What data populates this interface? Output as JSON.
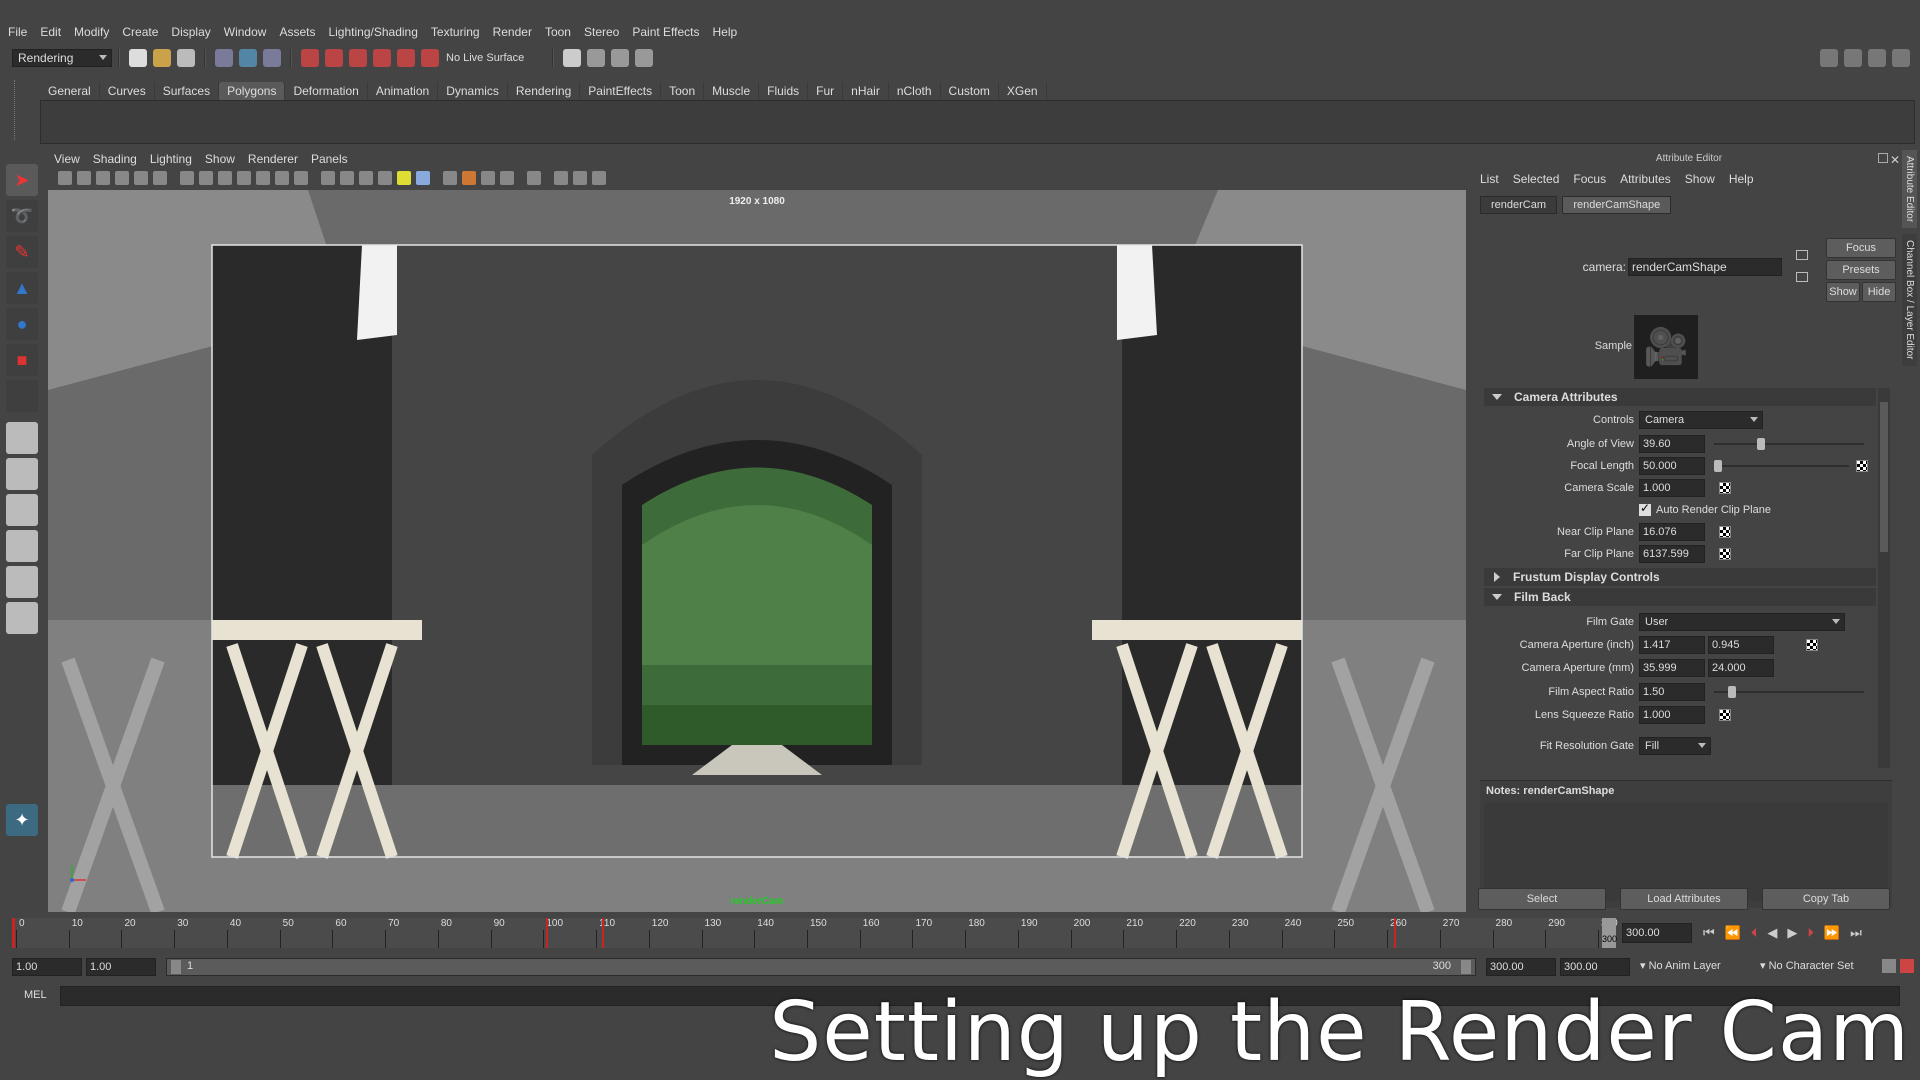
{
  "menubar": {
    "items": [
      "File",
      "Edit",
      "Modify",
      "Create",
      "Display",
      "Window",
      "Assets",
      "Lighting/Shading",
      "Texturing",
      "Render",
      "Toon",
      "Stereo",
      "Paint Effects",
      "Help"
    ]
  },
  "status_line": {
    "menu_set": "Rendering",
    "live_surface": "No Live Surface"
  },
  "shelf": {
    "tabs": [
      "General",
      "Curves",
      "Surfaces",
      "Polygons",
      "Deformation",
      "Animation",
      "Dynamics",
      "Rendering",
      "PaintEffects",
      "Toon",
      "Muscle",
      "Fluids",
      "Fur",
      "nHair",
      "nCloth",
      "Custom",
      "XGen"
    ],
    "active_tab": "Polygons"
  },
  "viewport": {
    "menu": [
      "View",
      "Shading",
      "Lighting",
      "Show",
      "Renderer",
      "Panels"
    ],
    "resolution_label": "1920 x 1080",
    "camera_name": "renderCam"
  },
  "attribute_editor": {
    "title": "Attribute Editor",
    "menu": [
      "List",
      "Selected",
      "Focus",
      "Attributes",
      "Show",
      "Help"
    ],
    "tabs": [
      "renderCam",
      "renderCamShape"
    ],
    "active_tab": "renderCamShape",
    "camera_label": "camera:",
    "camera_value": "renderCamShape",
    "buttons": {
      "focus": "Focus",
      "presets": "Presets",
      "show": "Show",
      "hide": "Hide"
    },
    "sample_label": "Sample",
    "camera_attributes": {
      "header": "Camera Attributes",
      "controls_label": "Controls",
      "controls_value": "Camera",
      "angle_of_view_label": "Angle of View",
      "angle_of_view": "39.60",
      "angle_of_view_frac": 0.3,
      "focal_length_label": "Focal Length",
      "focal_length": "50.000",
      "focal_length_frac": 0.0,
      "camera_scale_label": "Camera Scale",
      "camera_scale": "1.000",
      "auto_render_clip_label": "Auto Render Clip Plane",
      "auto_render_clip": true,
      "near_clip_label": "Near Clip Plane",
      "near_clip": "16.076",
      "far_clip_label": "Far Clip Plane",
      "far_clip": "6137.599"
    },
    "frustum_header": "Frustum Display Controls",
    "film_back": {
      "header": "Film Back",
      "film_gate_label": "Film Gate",
      "film_gate": "User",
      "aperture_inch_label": "Camera Aperture (inch)",
      "aperture_inch_x": "1.417",
      "aperture_inch_y": "0.945",
      "aperture_mm_label": "Camera Aperture (mm)",
      "aperture_mm_x": "35.999",
      "aperture_mm_y": "24.000",
      "film_aspect_label": "Film Aspect Ratio",
      "film_aspect": "1.50",
      "film_aspect_frac": 0.1,
      "lens_squeeze_label": "Lens Squeeze Ratio",
      "lens_squeeze": "1.000",
      "fit_resolution_label": "Fit Resolution Gate",
      "fit_resolution": "Fill"
    },
    "notes_label": "Notes:",
    "notes_target": "renderCamShape",
    "bottom_buttons": [
      "Select",
      "Load Attributes",
      "Copy Tab"
    ]
  },
  "side_tabs": [
    "Attribute Editor",
    "Channel Box / Layer Editor"
  ],
  "timeline": {
    "ticks": [
      "0",
      "10",
      "20",
      "30",
      "40",
      "50",
      "60",
      "70",
      "80",
      "90",
      "100",
      "110",
      "120",
      "130",
      "140",
      "150",
      "160",
      "170",
      "180",
      "190",
      "200",
      "210",
      "220",
      "230",
      "240",
      "250",
      "260",
      "270",
      "280",
      "290",
      "300"
    ],
    "current_frame": "300",
    "current_time_field": "300.00"
  },
  "range": {
    "start": "1.00",
    "playback_start": "1.00",
    "range_min_label": "1",
    "range_max_label": "300",
    "playback_end": "300.00",
    "end": "300.00",
    "anim_layer": "No Anim Layer",
    "character_set": "No Character Set"
  },
  "command_line": {
    "label": "MEL"
  },
  "caption": "Setting up the Render Cam",
  "colors": {
    "bg": "#444444",
    "field": "#2b2b2b",
    "accent": "#5285a6",
    "keyframe": "#cc2222"
  }
}
